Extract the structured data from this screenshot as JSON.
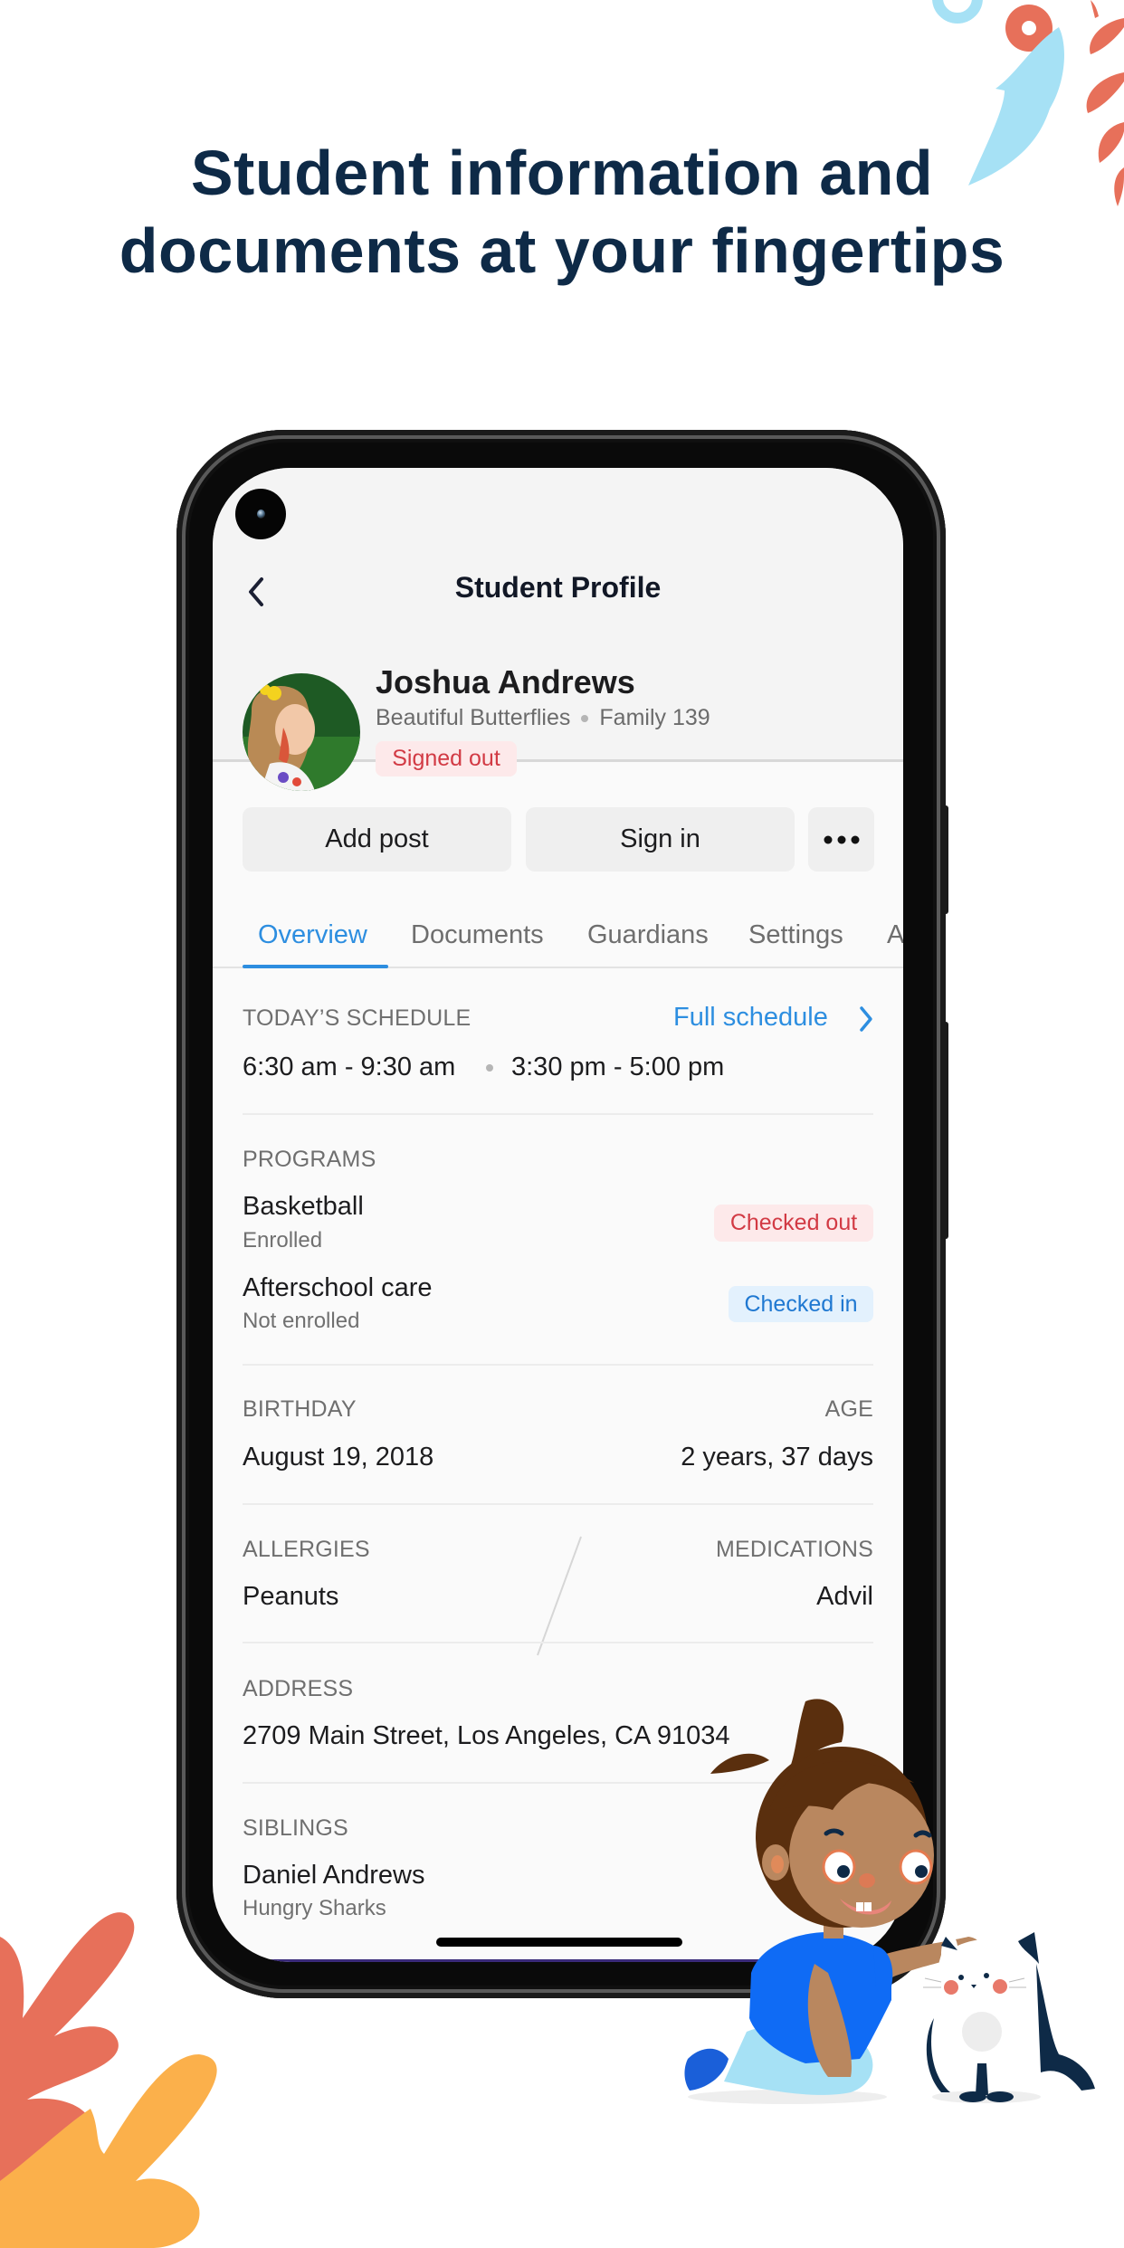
{
  "headline": {
    "line1": "Student information and",
    "line2": "documents at your fingertips"
  },
  "colors": {
    "headline": "#0e2a47",
    "accent": "#2d8ee0",
    "danger_text": "#d23a44",
    "danger_bg": "#fde9ea",
    "info_text": "#1f78d1",
    "info_bg": "#e3f1fd",
    "leaf_coral": "#e7705a",
    "leaf_orange": "#fbb04b",
    "leaf_blue": "#a6e1f5"
  },
  "app": {
    "title": "Student Profile",
    "back_icon": "chevron-left-icon",
    "profile": {
      "name": "Joshua Andrews",
      "classroom": "Beautiful Butterflies",
      "family": "Family 139",
      "status": "Signed out"
    },
    "actions": {
      "add_post": "Add post",
      "sign_in": "Sign in",
      "more_icon": "more-horizontal-icon"
    },
    "tabs": [
      {
        "label": "Overview",
        "active": true
      },
      {
        "label": "Documents",
        "active": false
      },
      {
        "label": "Guardians",
        "active": false
      },
      {
        "label": "Settings",
        "active": false
      },
      {
        "label": "A",
        "active": false
      }
    ],
    "schedule": {
      "label": "TODAY’S SCHEDULE",
      "link": "Full schedule",
      "slot1": "6:30 am - 9:30 am",
      "slot2": "3:30 pm - 5:00 pm"
    },
    "programs": {
      "label": "PROGRAMS",
      "items": [
        {
          "name": "Basketball",
          "enrollment": "Enrolled",
          "status": "Checked out"
        },
        {
          "name": "Afterschool care",
          "enrollment": "Not enrolled",
          "status": "Checked in"
        }
      ]
    },
    "birthday": {
      "label": "BIRTHDAY",
      "value": "August 19, 2018"
    },
    "age": {
      "label": "AGE",
      "value": "2 years, 37 days"
    },
    "allergies": {
      "label": "ALLERGIES",
      "value": "Peanuts"
    },
    "medications": {
      "label": "MEDICATIONS",
      "value": "Advil"
    },
    "address": {
      "label": "ADDRESS",
      "value": "2709 Main Street, Los Angeles, CA 91034"
    },
    "siblings": {
      "label": "SIBLINGS",
      "items": [
        {
          "name": "Daniel Andrews",
          "classroom": "Hungry Sharks"
        }
      ]
    }
  }
}
